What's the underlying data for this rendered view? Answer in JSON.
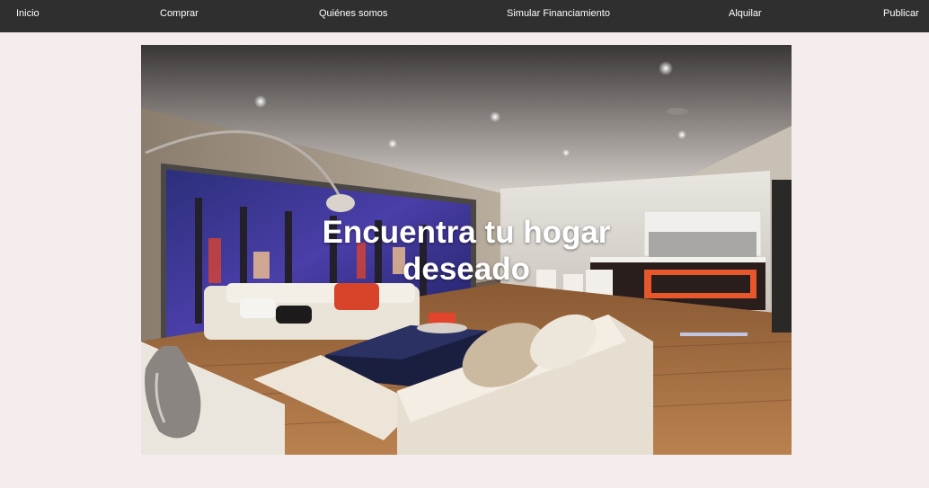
{
  "nav": {
    "items": [
      {
        "label": "Inicio"
      },
      {
        "label": "Comprar"
      },
      {
        "label": "Quiénes somos"
      },
      {
        "label": "Simular Financiamiento"
      },
      {
        "label": "Alquilar"
      },
      {
        "label": "Publicar"
      }
    ]
  },
  "hero": {
    "title_line1": "Encuentra tu hogar",
    "title_line2": "deseado"
  },
  "colors": {
    "nav_background": "#2f2f2f",
    "page_background": "#f4eced",
    "nav_text": "#ffffff"
  }
}
